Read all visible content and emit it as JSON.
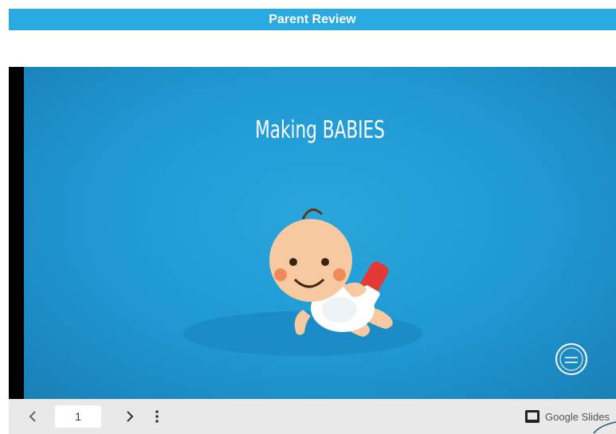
{
  "header": {
    "title": "Parent Review"
  },
  "slide": {
    "title": "Making BABIES"
  },
  "toolbar": {
    "page_number": "1",
    "brand_label": "Google Slides",
    "prev_icon": "chevron-left-icon",
    "next_icon": "chevron-right-icon",
    "more_icon": "more-vertical-icon",
    "brand_icon": "google-slides-icon"
  },
  "colors": {
    "header_bg": "#29aae1",
    "slide_bg": "#1f98d2",
    "toolbar_bg": "#e9e9e9"
  }
}
